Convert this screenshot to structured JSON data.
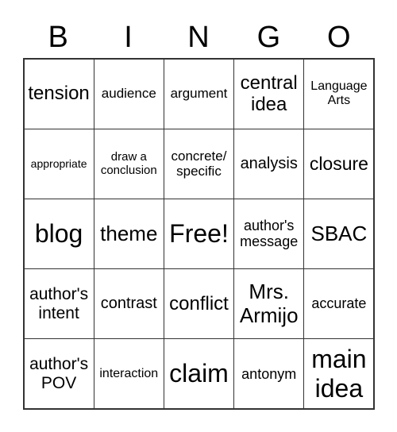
{
  "header": [
    "B",
    "I",
    "N",
    "G",
    "O"
  ],
  "cells": [
    [
      "tension",
      "audience",
      "argument",
      "central idea",
      "Language Arts"
    ],
    [
      "appropriate",
      "draw a conclusion",
      "concrete/ specific",
      "analysis",
      "closure"
    ],
    [
      "blog",
      "theme",
      "Free!",
      "author's message",
      "SBAC"
    ],
    [
      "author's intent",
      "contrast",
      "conflict",
      "Mrs. Armijo",
      "accurate"
    ],
    [
      "author's POV",
      "interaction",
      "claim",
      "antonym",
      "main idea"
    ]
  ]
}
